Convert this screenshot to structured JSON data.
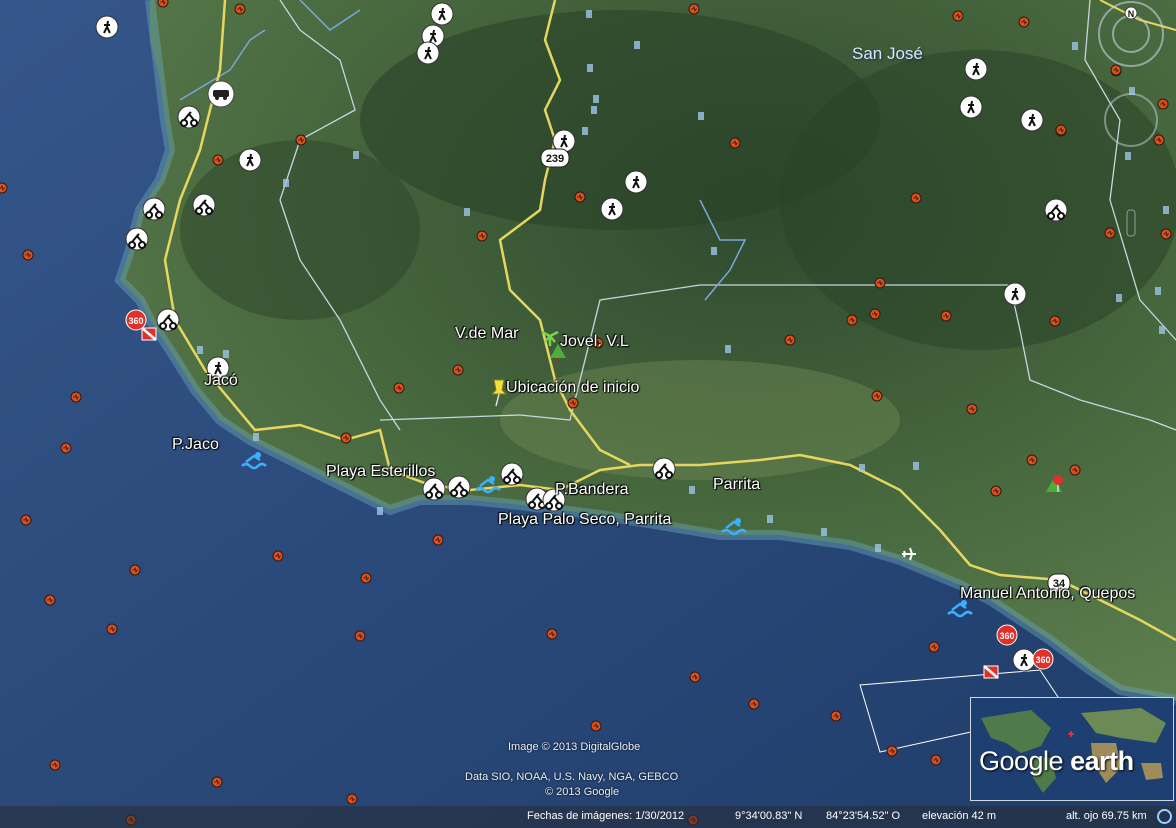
{
  "labels": {
    "san_jose": "San José",
    "v_de_mar": "V.de Mar",
    "jovel": "Jovel. V.L",
    "ubicacion": "Ubicación de inicio",
    "jaco": "Jacó",
    "p_jaco": "P.Jaco",
    "playa_esterillos": "Playa Esterillos",
    "p_bandera": "P.Bandera",
    "parrita": "Parrita",
    "playa_palo_seco": "Playa Palo Seco, Parrita",
    "manuel_antonio": "Manuel Antonio, Quepos"
  },
  "route_shields": {
    "r239": "239",
    "r34": "34"
  },
  "panorama_badge": "360",
  "credits": {
    "imagery": "Image © 2013 DigitalGlobe",
    "data": "Data SIO, NOAA, U.S. Navy, NGA, GEBCO",
    "google": "© 2013 Google"
  },
  "status_bar": {
    "imagery_date": "Fechas de imágenes: 1/30/2012",
    "lat": "9°34'00.83\" N",
    "lon": "84°23'54.52\" O",
    "elevation": "elevación    42 m",
    "eye_alt": "alt. ojo  69.75 km"
  },
  "overview": {
    "brand_a": "Google",
    "brand_b": " earth"
  },
  "nav": {
    "north": "N"
  },
  "colors": {
    "ocean": "#2c4f7c",
    "land": "#3d5a3a",
    "road": "#e6d660",
    "boundary": "#c8d4e0",
    "quake": "#e0501c"
  }
}
